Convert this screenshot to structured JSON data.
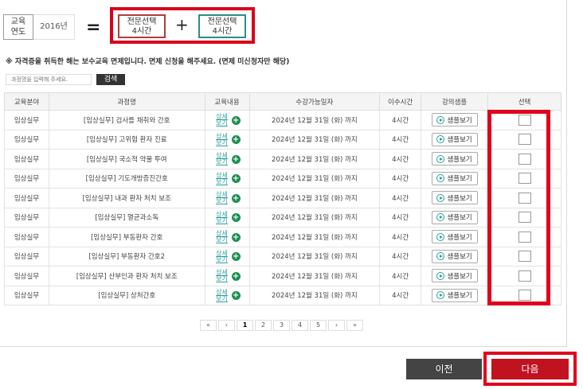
{
  "header": {
    "year_label": "교육\n연도",
    "year_value": "2016년",
    "equals": "=",
    "plus": "+",
    "credit_a": "전문선택\n4시간",
    "credit_b": "전문선택\n4시간"
  },
  "notice": "※ 자격증을 취득한 해는 보수교육 면제입니다. 면제 신청을 해주세요. (면제 미신청자만 해당)",
  "search": {
    "placeholder": "과정명을 입력해 주세요.",
    "button": "검색"
  },
  "table": {
    "headers": [
      "교육분야",
      "과정명",
      "교육내용",
      "수강가능일자",
      "이수시간",
      "강의샘플",
      "선택"
    ],
    "detail_label": "상세\n보기",
    "sample_label": "샘플보기",
    "rows": [
      {
        "field": "임상실무",
        "course": "[임상실무] 검사를 채취와 간호",
        "date": "2024년 12월 31일 (화) 까지",
        "hours": "4시간"
      },
      {
        "field": "임상실무",
        "course": "[임상실무] 고위험 환자 진료",
        "date": "2024년 12월 31일 (화) 까지",
        "hours": "4시간"
      },
      {
        "field": "임상실무",
        "course": "[임상실무] 국소적 약물 투여",
        "date": "2024년 12월 31일 (화) 까지",
        "hours": "4시간"
      },
      {
        "field": "임상실무",
        "course": "[임상실무] 기도개방증진간호",
        "date": "2024년 12월 31일 (화) 까지",
        "hours": "4시간"
      },
      {
        "field": "임상실무",
        "course": "[임상실무] 내과 환자 처치 보조",
        "date": "2024년 12월 31일 (화) 까지",
        "hours": "4시간"
      },
      {
        "field": "임상실무",
        "course": "[임상실무] 멸균과소독",
        "date": "2024년 12월 31일 (화) 까지",
        "hours": "4시간"
      },
      {
        "field": "임상실무",
        "course": "[임상실무] 부동환자 간호",
        "date": "2024년 12월 31일 (화) 까지",
        "hours": "4시간"
      },
      {
        "field": "임상실무",
        "course": "[임상실무] 부동환자 간호2",
        "date": "2024년 12월 31일 (화) 까지",
        "hours": "4시간"
      },
      {
        "field": "임상실무",
        "course": "[임상실무] 산부인과 환자 처치 보조",
        "date": "2024년 12월 31일 (화) 까지",
        "hours": "4시간"
      },
      {
        "field": "임상실무",
        "course": "[임상실무] 상처간호",
        "date": "2024년 12월 31일 (화) 까지",
        "hours": "4시간"
      }
    ]
  },
  "pagination": [
    "«",
    "‹",
    "1",
    "2",
    "3",
    "4",
    "5",
    "›",
    "»"
  ],
  "current_page": "1",
  "buttons": {
    "prev": "이전",
    "next": "다음"
  }
}
